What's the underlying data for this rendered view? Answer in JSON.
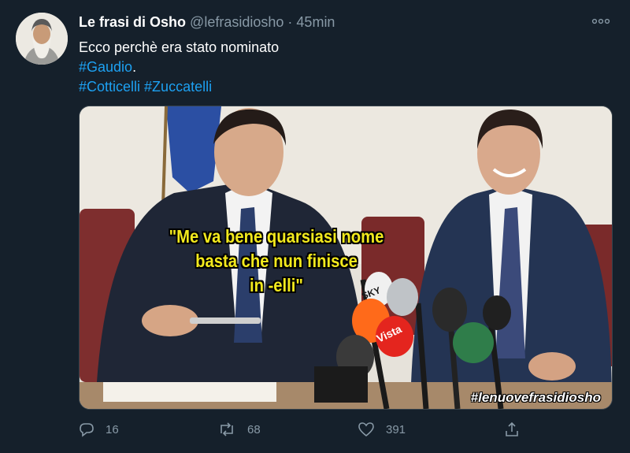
{
  "tweet": {
    "author_name": "Le frasi di Osho",
    "author_handle": "@lefrasidiosho",
    "separator": "·",
    "time": "45min",
    "line1": "Ecco perchè era stato nominato",
    "line2_tag": "#Gaudio",
    "line2_suffix": ".",
    "line3_tag1": "#Cotticelli",
    "line3_tag2": "#Zuccatelli",
    "more_icon": "ellipsis-icon"
  },
  "media": {
    "caption_line1": "\"Me va bene quarsiasi nome",
    "caption_line2": "basta che nun finisce",
    "caption_line3": "in -elli\"",
    "watermark": "#lenuovefrasidiosho",
    "mic_labels": [
      "SKY",
      "Vista"
    ]
  },
  "actions": {
    "reply_count": "16",
    "retweet_count": "68",
    "like_count": "391",
    "icons": [
      "reply-icon",
      "retweet-icon",
      "like-icon",
      "share-icon"
    ]
  },
  "colors": {
    "background": "#15202b",
    "hashtag": "#1da1f2",
    "muted": "#8899a6",
    "caption": "#f2e91d"
  }
}
